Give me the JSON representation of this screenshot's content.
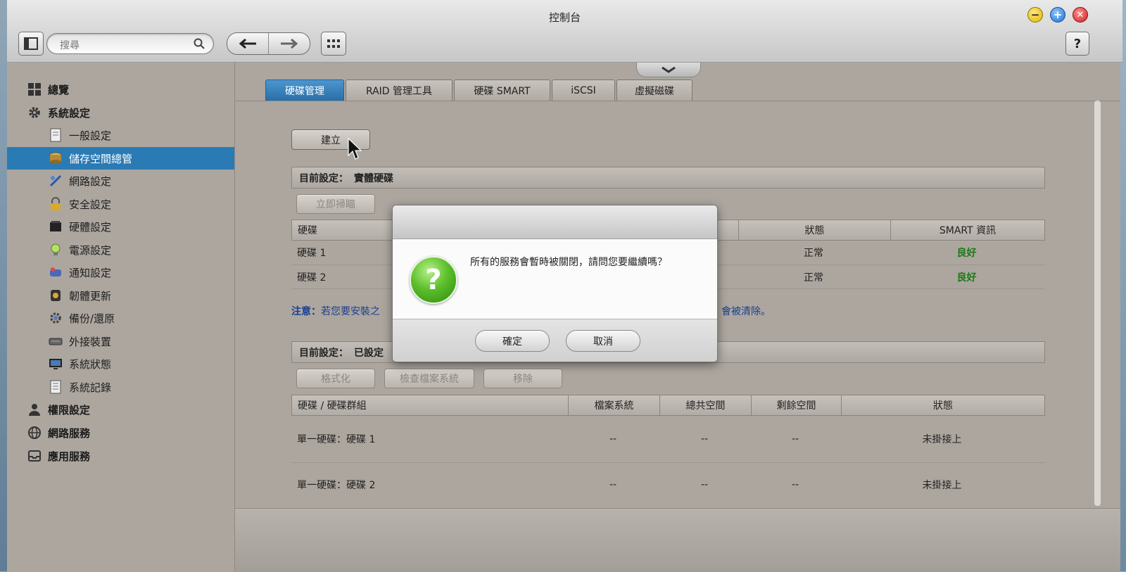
{
  "window": {
    "title": "控制台"
  },
  "toolbar": {
    "search_placeholder": "搜尋",
    "help_label": "?"
  },
  "sidebar": {
    "items": [
      {
        "label": "總覽",
        "icon": "overview-icon",
        "level": "top"
      },
      {
        "label": "系統設定",
        "icon": "gear-icon",
        "level": "top"
      },
      {
        "label": "一般設定",
        "icon": "general-settings-icon",
        "level": "sub"
      },
      {
        "label": "儲存空間總管",
        "icon": "storage-icon",
        "level": "sub",
        "selected": true
      },
      {
        "label": "網路設定",
        "icon": "network-icon",
        "level": "sub"
      },
      {
        "label": "安全設定",
        "icon": "lock-icon",
        "level": "sub"
      },
      {
        "label": "硬體設定",
        "icon": "hardware-icon",
        "level": "sub"
      },
      {
        "label": "電源設定",
        "icon": "power-icon",
        "level": "sub"
      },
      {
        "label": "通知設定",
        "icon": "notification-icon",
        "level": "sub"
      },
      {
        "label": "韌體更新",
        "icon": "firmware-icon",
        "level": "sub"
      },
      {
        "label": "備份/還原",
        "icon": "backup-icon",
        "level": "sub"
      },
      {
        "label": "外接裝置",
        "icon": "external-device-icon",
        "level": "sub"
      },
      {
        "label": "系統狀態",
        "icon": "monitor-icon",
        "level": "sub"
      },
      {
        "label": "系統記錄",
        "icon": "log-icon",
        "level": "sub"
      },
      {
        "label": "權限設定",
        "icon": "user-icon",
        "level": "top"
      },
      {
        "label": "網路服務",
        "icon": "globe-icon",
        "level": "top"
      },
      {
        "label": "應用服務",
        "icon": "inbox-icon",
        "level": "top"
      }
    ]
  },
  "tabs": [
    {
      "label": "硬碟管理",
      "active": true
    },
    {
      "label": "RAID 管理工具",
      "active": false
    },
    {
      "label": "硬碟 SMART",
      "active": false
    },
    {
      "label": "iSCSI",
      "active": false
    },
    {
      "label": "虛擬磁碟",
      "active": false
    }
  ],
  "create_button": "建立",
  "physical": {
    "header_label": "目前設定：",
    "header_value": "實體硬碟",
    "scan_button": "立即掃瞄",
    "columns": [
      "硬碟",
      "狀態",
      "SMART 資訊"
    ],
    "rows": [
      {
        "disk": "硬碟 1",
        "status": "正常",
        "smart": "良好"
      },
      {
        "disk": "硬碟 2",
        "status": "正常",
        "smart": "良好"
      }
    ]
  },
  "note": {
    "label": "注意：",
    "text_start": "若您要安裝之",
    "text_end": "會被清除。"
  },
  "volume": {
    "header_label": "目前設定：",
    "header_value": "已設定",
    "buttons": [
      "格式化",
      "檢查檔案系統",
      "移除"
    ],
    "columns": [
      "硬碟 / 硬碟群組",
      "檔案系統",
      "總共空間",
      "剩餘空間",
      "狀態"
    ],
    "rows": [
      {
        "name": "單一硬碟：硬碟 1",
        "fs": "--",
        "total": "--",
        "free": "--",
        "status": "未掛接上"
      },
      {
        "name": "單一硬碟：硬碟 2",
        "fs": "--",
        "total": "--",
        "free": "--",
        "status": "未掛接上"
      }
    ]
  },
  "dialog": {
    "message": "所有的服務會暫時被關閉，請問您要繼續嗎？",
    "confirm": "確定",
    "cancel": "取消"
  }
}
